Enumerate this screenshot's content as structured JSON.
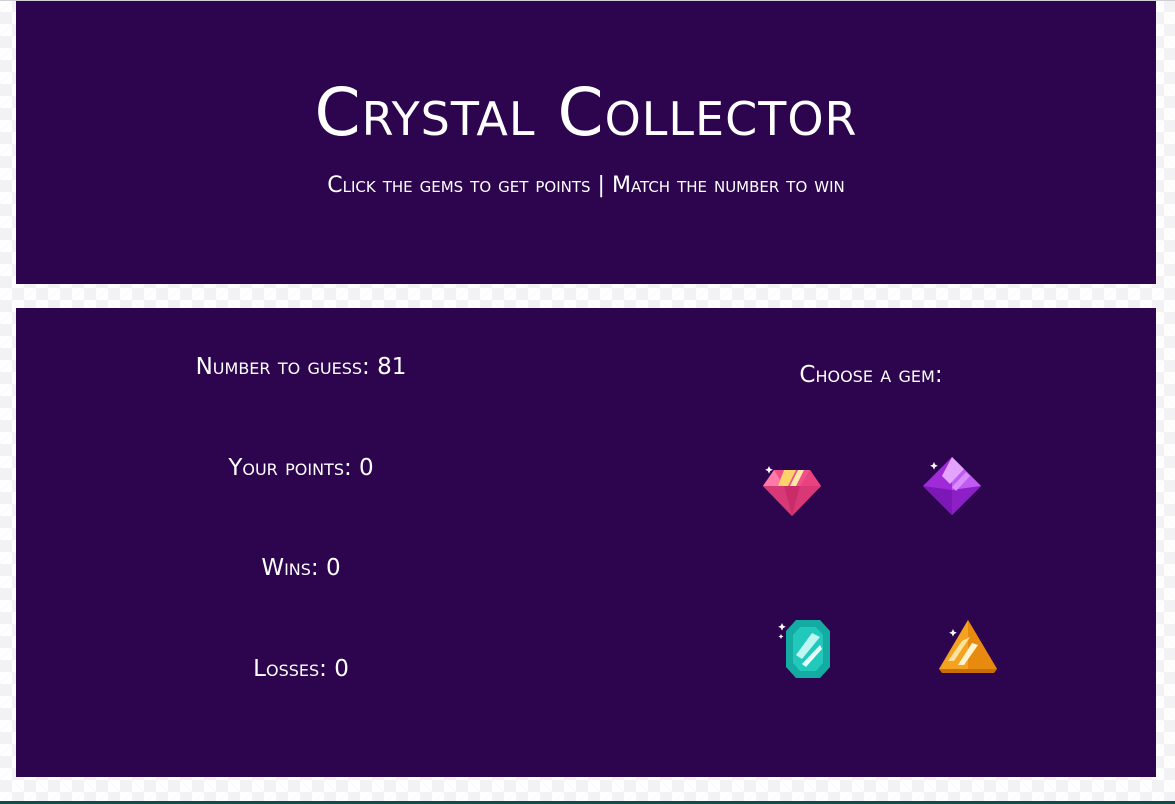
{
  "header": {
    "title": "Crystal Collector",
    "subtitle": "Click the gems to get points | Match the number to win"
  },
  "stats": {
    "target_label": "Number to guess: ",
    "target_value": "81",
    "points_label": "Your points: ",
    "points_value": "0",
    "wins_label": "Wins: ",
    "wins_value": "0",
    "losses_label": "Losses: ",
    "losses_value": "0"
  },
  "gems": {
    "prompt": "Choose a gem:",
    "items": [
      {
        "name": "pink-diamond",
        "icon": "pink-diamond-gem-icon",
        "color": "#f0508a"
      },
      {
        "name": "purple-octahedron",
        "icon": "purple-crystal-gem-icon",
        "color": "#a02ad8"
      },
      {
        "name": "teal-emerald",
        "icon": "teal-emerald-gem-icon",
        "color": "#22c8bc"
      },
      {
        "name": "orange-pyramid",
        "icon": "orange-pyramid-gem-icon",
        "color": "#f5a21f"
      }
    ]
  },
  "colors": {
    "panel_background": "#2d054f",
    "text": "#ffffff",
    "page_background": "#f2f2f4"
  }
}
